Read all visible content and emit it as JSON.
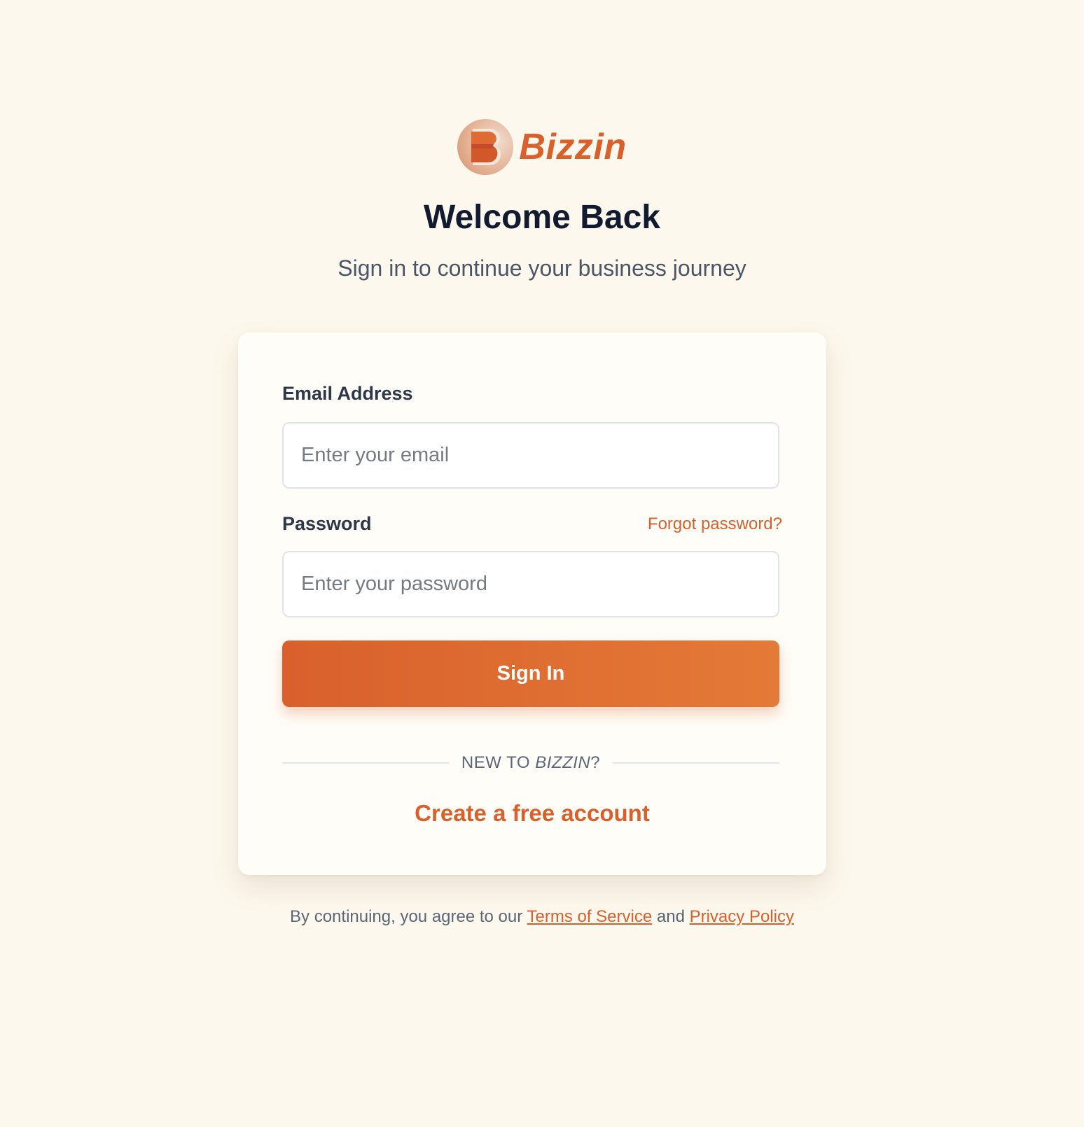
{
  "brand": {
    "name": "Bizzin",
    "logo_icon": "b-letter-logo-icon",
    "accent_color": "#d9602a"
  },
  "header": {
    "title": "Welcome Back",
    "subtitle": "Sign in to continue your business journey"
  },
  "form": {
    "email": {
      "label": "Email Address",
      "placeholder": "Enter your email",
      "value": ""
    },
    "password": {
      "label": "Password",
      "placeholder": "Enter your password",
      "value": "",
      "forgot_label": "Forgot password?"
    },
    "submit_label": "Sign In",
    "divider": {
      "prefix": "NEW TO ",
      "brand": "BIZZIN",
      "suffix": "?"
    },
    "create_account_label": "Create a free account"
  },
  "footer": {
    "prefix": "By continuing, you agree to our ",
    "terms_label": "Terms of Service",
    "middle": " and ",
    "privacy_label": "Privacy Policy"
  }
}
